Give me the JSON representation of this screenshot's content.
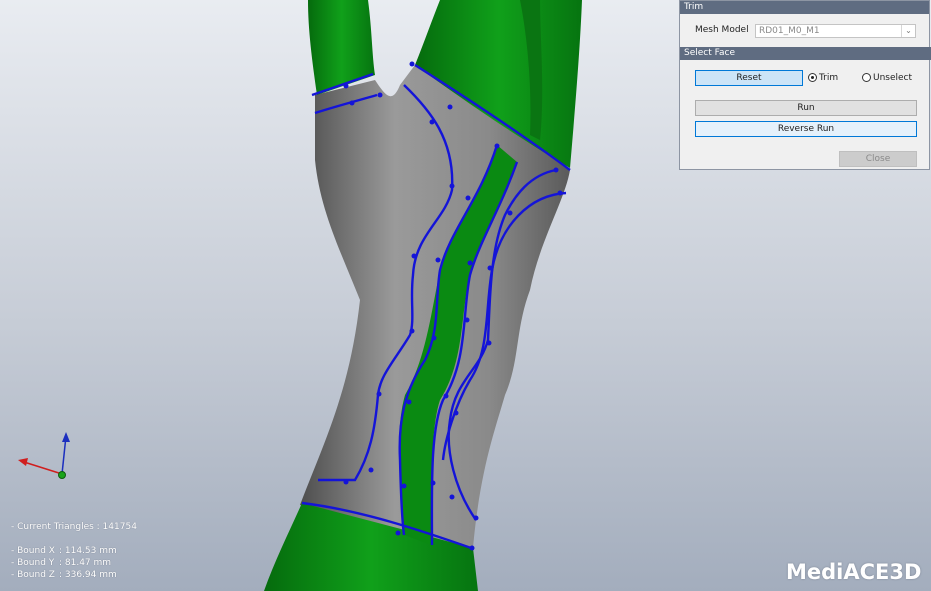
{
  "trim_panel": {
    "title": "Trim",
    "mesh_model_label": "Mesh Model",
    "mesh_model_value": "RD01_M0_M1",
    "select_face_header": "Select Face",
    "reset_label": "Reset",
    "trim_option_label": "Trim",
    "unselect_option_label": "Unselect",
    "selected_option": "Trim",
    "run_label": "Run",
    "reverse_run_label": "Reverse Run",
    "close_label": "Close",
    "close_enabled": false
  },
  "stats": {
    "current_triangles": "- Current Triangles : 141754",
    "bound_x_label": "- Bound X",
    "bound_x_value": ": 114.53 mm",
    "bound_y_label": "- Bound Y",
    "bound_y_value": ": 81.47 mm",
    "bound_z_label": "- Bound Z",
    "bound_z_value": ": 336.94 mm"
  },
  "logo_text": "MediACE3D",
  "colors": {
    "mesh_green": "#0c8a16",
    "mesh_gray": "#8c8c8c",
    "trim_line": "#1414d8",
    "axis_x": "#d01e1e",
    "axis_y": "#1c2fbf",
    "axis_z": "#1aa31a",
    "panel_header": "#5f6c81"
  }
}
